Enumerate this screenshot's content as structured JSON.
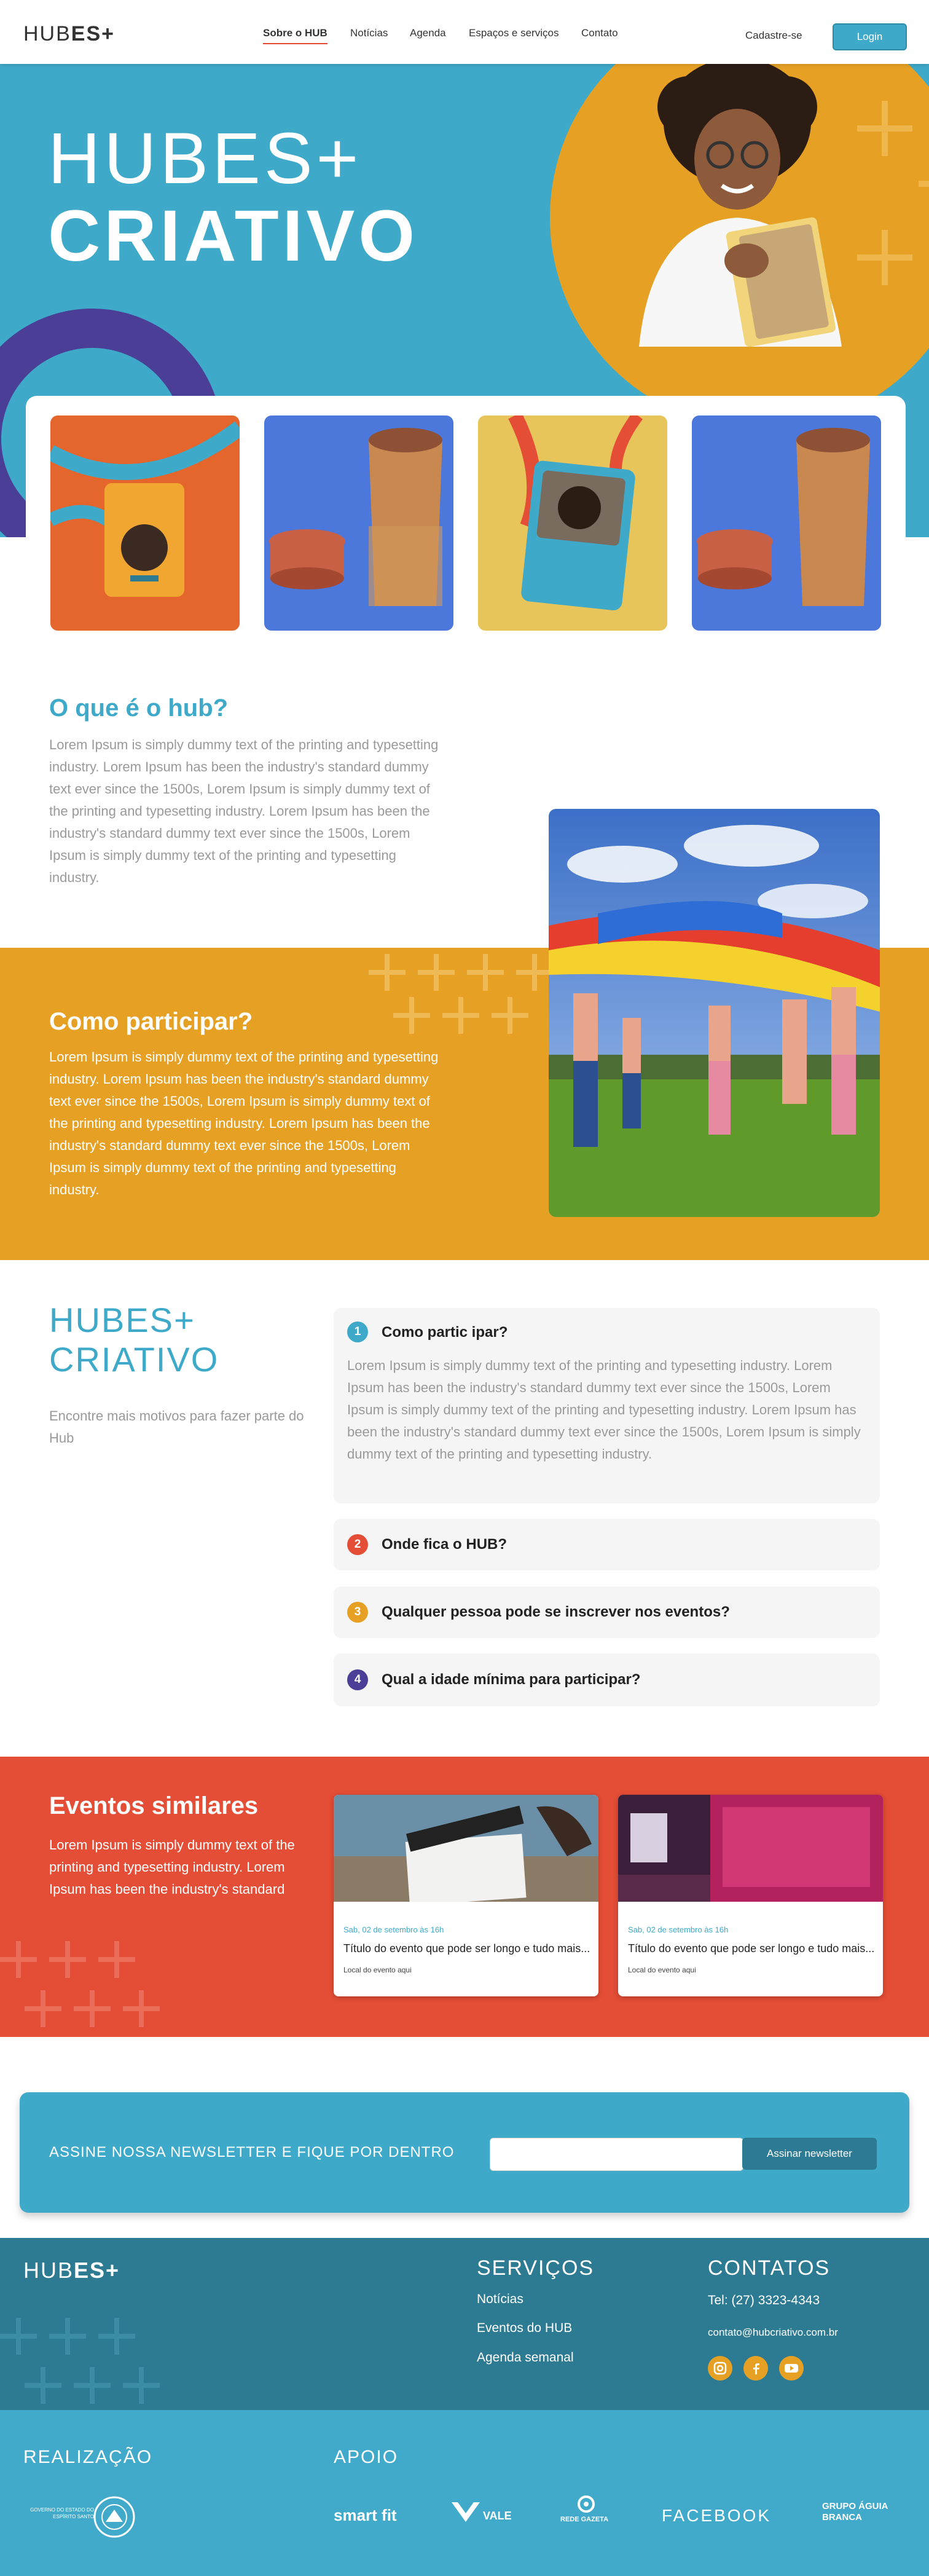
{
  "header": {
    "logo": {
      "thin": "HUB",
      "bold": "ES+"
    },
    "nav": [
      "Sobre o HUB",
      "Notícias",
      "Agenda",
      "Espaços e serviços",
      "Contato"
    ],
    "signup": "Cadastre-se",
    "login": "Login"
  },
  "hero": {
    "title_line1": "HUBES+",
    "title_line2": "CRIATIVO"
  },
  "about": {
    "title": "O que é o hub?",
    "text": "Lorem Ipsum is simply dummy text of the printing and typesetting industry. Lorem Ipsum has been the industry's standard dummy text ever since the 1500s,  Lorem Ipsum is simply dummy text of the printing and typesetting industry. Lorem Ipsum has been the industry's standard dummy text ever since the 1500s, Lorem Ipsum is simply dummy text of the printing and typesetting industry."
  },
  "participate": {
    "title": "Como participar?",
    "text": "Lorem Ipsum is simply dummy text of the printing and typesetting industry. Lorem Ipsum has been the industry's standard dummy text ever since the 1500s,  Lorem Ipsum is simply dummy text of the printing and typesetting industry. Lorem Ipsum has been the industry's standard dummy text ever since the 1500s, Lorem Ipsum is simply dummy text of the printing and typesetting industry."
  },
  "faq": {
    "logo_line1": "HUBES+",
    "logo_line2": "CRIATIVO",
    "tagline": "Encontre mais motivos para fazer parte do Hub",
    "items": [
      {
        "num": "1",
        "question": "Como partic ipar?",
        "answer": "Lorem Ipsum is simply dummy text of the printing and typesetting industry. Lorem Ipsum has been the industry's standard dummy text ever since the 1500s,  Lorem Ipsum is simply dummy text of the printing and typesetting industry. Lorem Ipsum has been the industry's standard dummy text ever since the 1500s, Lorem Ipsum is simply dummy text of the printing and typesetting industry.",
        "color": "#3ea9c9"
      },
      {
        "num": "2",
        "question": "Onde fica o HUB?",
        "color": "#e44d36"
      },
      {
        "num": "3",
        "question": "Qualquer pessoa pode se inscrever nos eventos?",
        "color": "#e6a125"
      },
      {
        "num": "4",
        "question": "Qual a idade mínima para participar?",
        "color": "#4a3e96"
      }
    ]
  },
  "events": {
    "title": "Eventos similares",
    "text": "Lorem Ipsum is simply dummy text of the printing and typesetting industry. Lorem Ipsum has been the industry's standard",
    "cards": [
      {
        "date": "Sab, 02 de setembro às 16h",
        "title": "Título do evento que pode ser longo e tudo mais...",
        "location": "Local do evento aqui"
      },
      {
        "date": "Sab, 02 de setembro às 16h",
        "title": "Título do evento que pode ser longo e tudo mais...",
        "location": "Local do evento aqui"
      }
    ]
  },
  "newsletter": {
    "label": "ASSINE NOSSA NEWSLETTER E FIQUE POR DENTRO",
    "placeholder": "",
    "button": "Assinar newsletter"
  },
  "footer": {
    "logo": {
      "thin": "HUB",
      "bold": "ES+"
    },
    "services_title": "SERVIÇOS",
    "services": [
      "Notícias",
      "Eventos do HUB",
      "Agenda semanal"
    ],
    "contacts_title": "CONTATOS",
    "phone": "Tel: (27) 3323-4343",
    "email": "contato@hubcriativo.com.br",
    "realizacao_title": "REALIZAÇÃO",
    "gov_text": "GOVERNO DO ESTADO DO ESPÍRITO SANTO",
    "apoio_title": "APOIO",
    "sponsors": [
      "smart fit",
      "VALE",
      "REDE GAZETA",
      "FACEBOOK",
      "GRUPO ÁGUIA BRANCA"
    ]
  },
  "colors": {
    "blue": "#3fa9c9",
    "orange": "#e6a125",
    "red": "#e44d36",
    "purple": "#4a3e96",
    "dark_teal": "#2d7b93"
  }
}
